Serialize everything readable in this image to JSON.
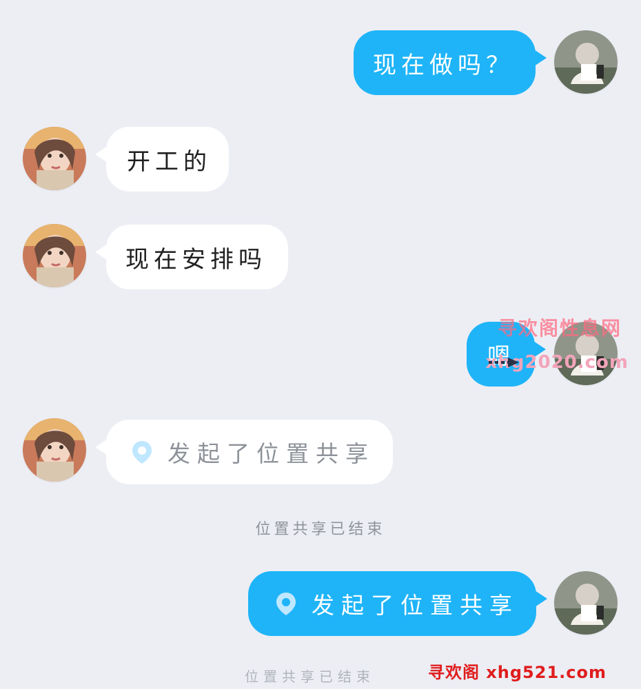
{
  "messages": [
    {
      "text": "现在做吗？"
    },
    {
      "text": "开工的"
    },
    {
      "text": "现在安排吗"
    },
    {
      "text": "嗯"
    },
    {
      "text": "发起了位置共享"
    },
    {
      "text": "发起了位置共享"
    }
  ],
  "system": {
    "location_ended": "位置共享已结束",
    "partial_location_ended": "位置共享已结束"
  },
  "watermarks": {
    "top_line1": "寻欢阁性息网",
    "top_line2": "xhg2020.com",
    "bottom": "寻欢阁 xhg521.com"
  },
  "colors": {
    "background": "#eceef4",
    "outgoing_bubble": "#1fb4f8",
    "incoming_bubble": "#ffffff",
    "location_pin": "#bfe7ff",
    "system_text": "#8f949b",
    "watermark_red": "#e01d1d"
  },
  "icons": {
    "location_pin": "location-pin-icon"
  }
}
